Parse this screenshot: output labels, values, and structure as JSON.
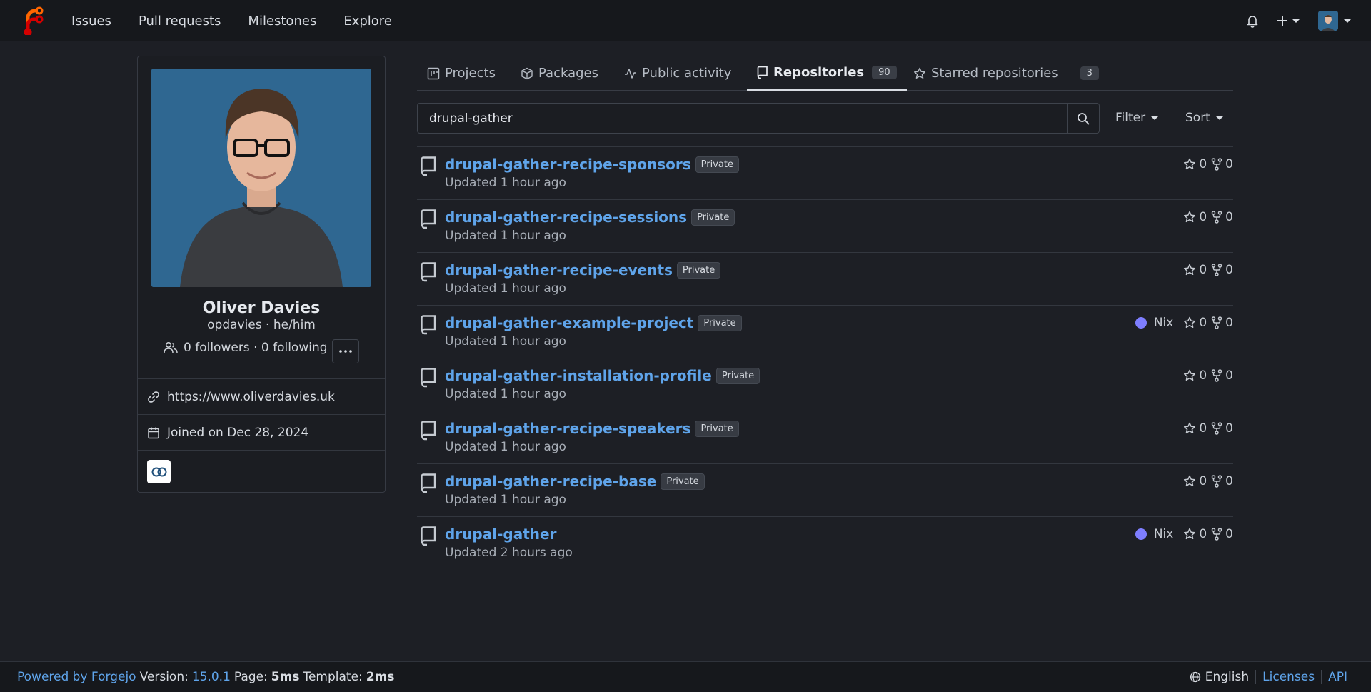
{
  "nav": {
    "logo": "forgejo-logo",
    "links": [
      "Issues",
      "Pull requests",
      "Milestones",
      "Explore"
    ]
  },
  "profile": {
    "name": "Oliver Davies",
    "subtitle": "opdavies · he/him",
    "followers_text": "0 followers · 0 following",
    "website": "https://www.oliverdavies.uk",
    "joined": "Joined on Dec 28, 2024"
  },
  "tabs": {
    "projects": "Projects",
    "packages": "Packages",
    "activity": "Public activity",
    "repositories": "Repositories",
    "repositories_count": "90",
    "starred": "Starred repositories",
    "starred_count": "3"
  },
  "search": {
    "value": "drupal-gather"
  },
  "controls": {
    "filter": "Filter",
    "sort": "Sort"
  },
  "repos": [
    {
      "name": "drupal-gather-recipe-sponsors",
      "badge": "Private",
      "updated": "Updated 1 hour ago",
      "lang": "",
      "stars": "0",
      "forks": "0"
    },
    {
      "name": "drupal-gather-recipe-sessions",
      "badge": "Private",
      "updated": "Updated 1 hour ago",
      "lang": "",
      "stars": "0",
      "forks": "0"
    },
    {
      "name": "drupal-gather-recipe-events",
      "badge": "Private",
      "updated": "Updated 1 hour ago",
      "lang": "",
      "stars": "0",
      "forks": "0"
    },
    {
      "name": "drupal-gather-example-project",
      "badge": "Private",
      "updated": "Updated 1 hour ago",
      "lang": "Nix",
      "stars": "0",
      "forks": "0"
    },
    {
      "name": "drupal-gather-installation-profile",
      "badge": "Private",
      "updated": "Updated 1 hour ago",
      "lang": "",
      "stars": "0",
      "forks": "0"
    },
    {
      "name": "drupal-gather-recipe-speakers",
      "badge": "Private",
      "updated": "Updated 1 hour ago",
      "lang": "",
      "stars": "0",
      "forks": "0"
    },
    {
      "name": "drupal-gather-recipe-base",
      "badge": "Private",
      "updated": "Updated 1 hour ago",
      "lang": "",
      "stars": "0",
      "forks": "0"
    },
    {
      "name": "drupal-gather",
      "badge": "",
      "updated": "Updated 2 hours ago",
      "lang": "Nix",
      "stars": "0",
      "forks": "0"
    }
  ],
  "colors": {
    "link": "#5fa4ea",
    "nix": "#7e7eff",
    "background": "#1d1f25"
  },
  "footer": {
    "powered": "Powered by Forgejo",
    "version_label": "Version:",
    "version": "15.0.1",
    "page_label": "Page:",
    "page_time": "5ms",
    "template_label": "Template:",
    "template_time": "2ms",
    "language": "English",
    "licenses": "Licenses",
    "api": "API"
  }
}
